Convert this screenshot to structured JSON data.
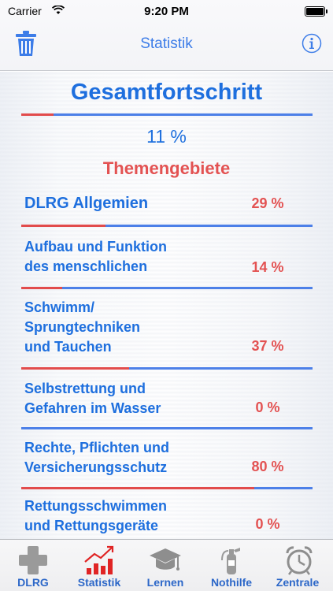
{
  "status_bar": {
    "carrier": "Carrier",
    "time": "9:20 PM"
  },
  "nav": {
    "title": "Statistik",
    "left_icon": "trash-icon",
    "right_icon": "info-icon"
  },
  "overall": {
    "title": "Gesamtfortschritt",
    "percent_label": "11 %",
    "progress": 0.11
  },
  "section_title": "Themengebiete",
  "topics": [
    {
      "lines": [
        "DLRG Allgemien"
      ],
      "percent_label": "29 %",
      "progress": 0.29
    },
    {
      "lines": [
        "Aufbau und Funktion",
        "des menschlichen"
      ],
      "percent_label": "14 %",
      "progress": 0.14
    },
    {
      "lines": [
        "Schwimm/",
        "Sprungtechniken",
        "und Tauchen"
      ],
      "percent_label": "37 %",
      "progress": 0.37
    },
    {
      "lines": [
        "Selbstrettung und",
        "Gefahren im Wasser"
      ],
      "percent_label": "0 %",
      "progress": 0.0
    },
    {
      "lines": [
        "Rechte, Pflichten und",
        "Versicherungsschutz"
      ],
      "percent_label": "80 %",
      "progress": 0.8
    },
    {
      "lines": [
        "Rettungsschwimmen",
        "und Rettungsgeräte"
      ],
      "percent_label": "0 %",
      "progress": 0.0
    }
  ],
  "tabs": [
    {
      "label": "DLRG",
      "icon": "cross-icon",
      "active": false
    },
    {
      "label": "Statistik",
      "icon": "bar-chart-icon",
      "active": true
    },
    {
      "label": "Lernen",
      "icon": "graduation-cap-icon",
      "active": false
    },
    {
      "label": "Nothilfe",
      "icon": "fire-extinguisher-icon",
      "active": false
    },
    {
      "label": "Zentrale",
      "icon": "alarm-clock-icon",
      "active": false
    }
  ],
  "colors": {
    "accent_blue": "#1e6fde",
    "accent_red": "#e35252",
    "bar_blue": "#4d80e8",
    "bar_red": "#e24c4c"
  }
}
